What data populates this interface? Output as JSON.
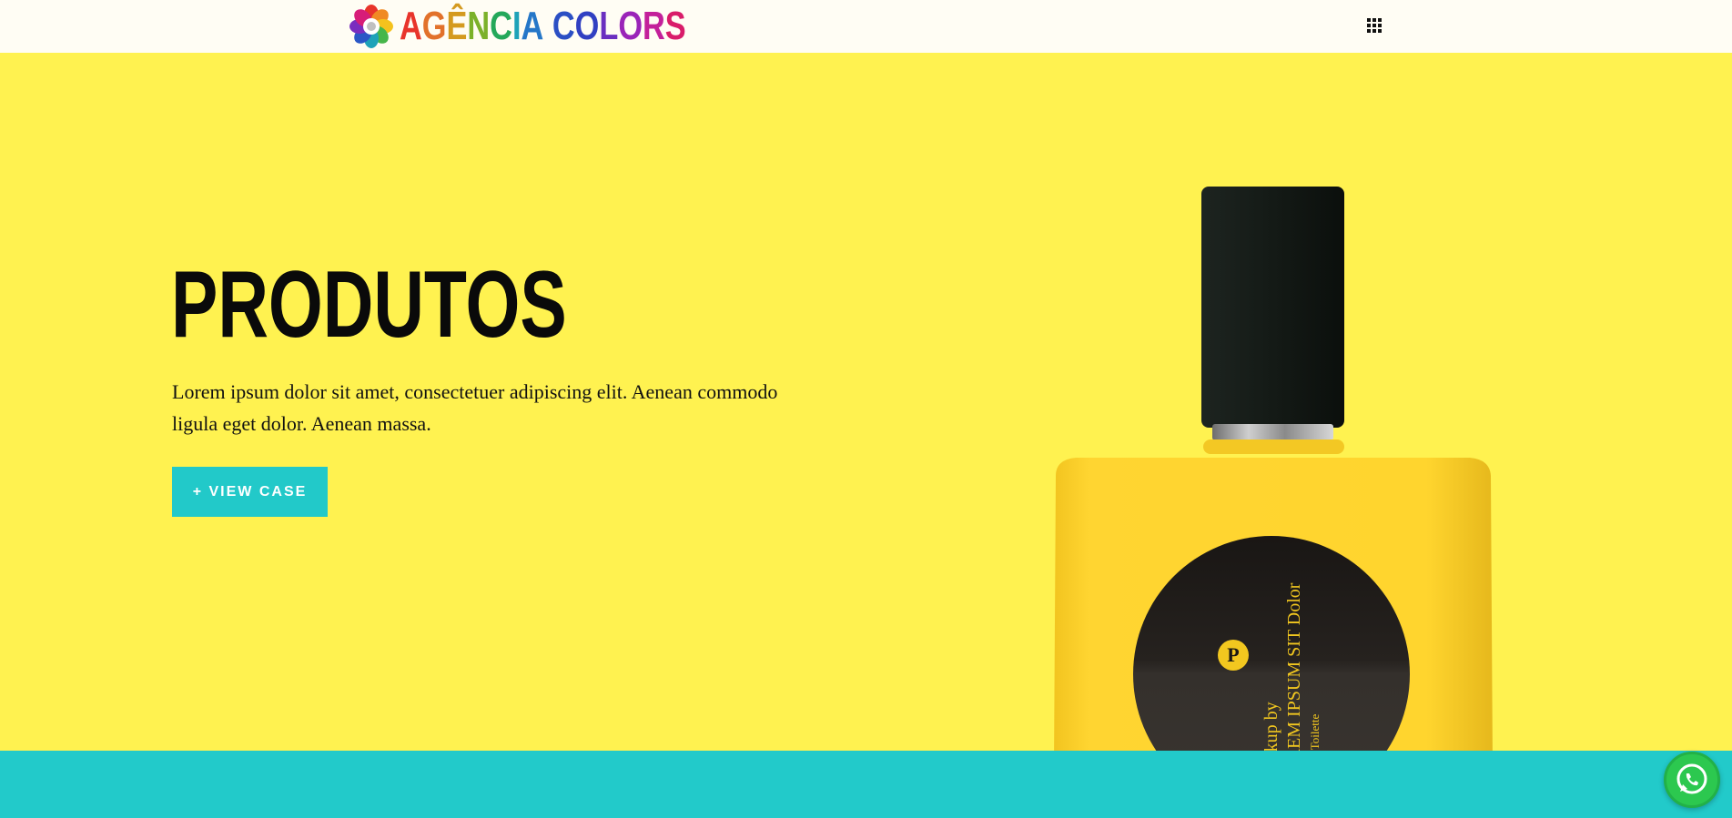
{
  "header": {
    "logo_parts": [
      "A",
      "G",
      "Ê",
      "N",
      "C",
      "I",
      "A",
      " ",
      "C",
      "O",
      "L",
      "O",
      "R",
      "S"
    ],
    "logo_colors": [
      "#e8342b",
      "#e2712a",
      "#d49a1f",
      "#7bb12a",
      "#24a85a",
      "#1ea2b8",
      "#2577c8",
      "#2d5fc5",
      "#2b4fc4",
      "#3140c2",
      "#6a2fc0",
      "#9a24b8",
      "#c3209a",
      "#d91c6a"
    ],
    "menu_icon": "grid-icon"
  },
  "hero": {
    "title": "PRODUTOS",
    "text": "Lorem ipsum dolor sit amet, consectetuer adipiscing elit. Aenean commodo ligula eget dolor. Aenean massa.",
    "button_label": "+ VIEW CASE",
    "background": "#fff250",
    "button_color": "#22c9c9"
  },
  "bottle": {
    "badge_letter": "P",
    "label_line1": "Mockup by",
    "label_line2": "LOREM IPSUM SIT Dolor",
    "label_line3": "Eau de Toilette"
  },
  "teal_section": {
    "color": "#22caca"
  },
  "whatsapp": {
    "icon": "whatsapp-icon"
  }
}
